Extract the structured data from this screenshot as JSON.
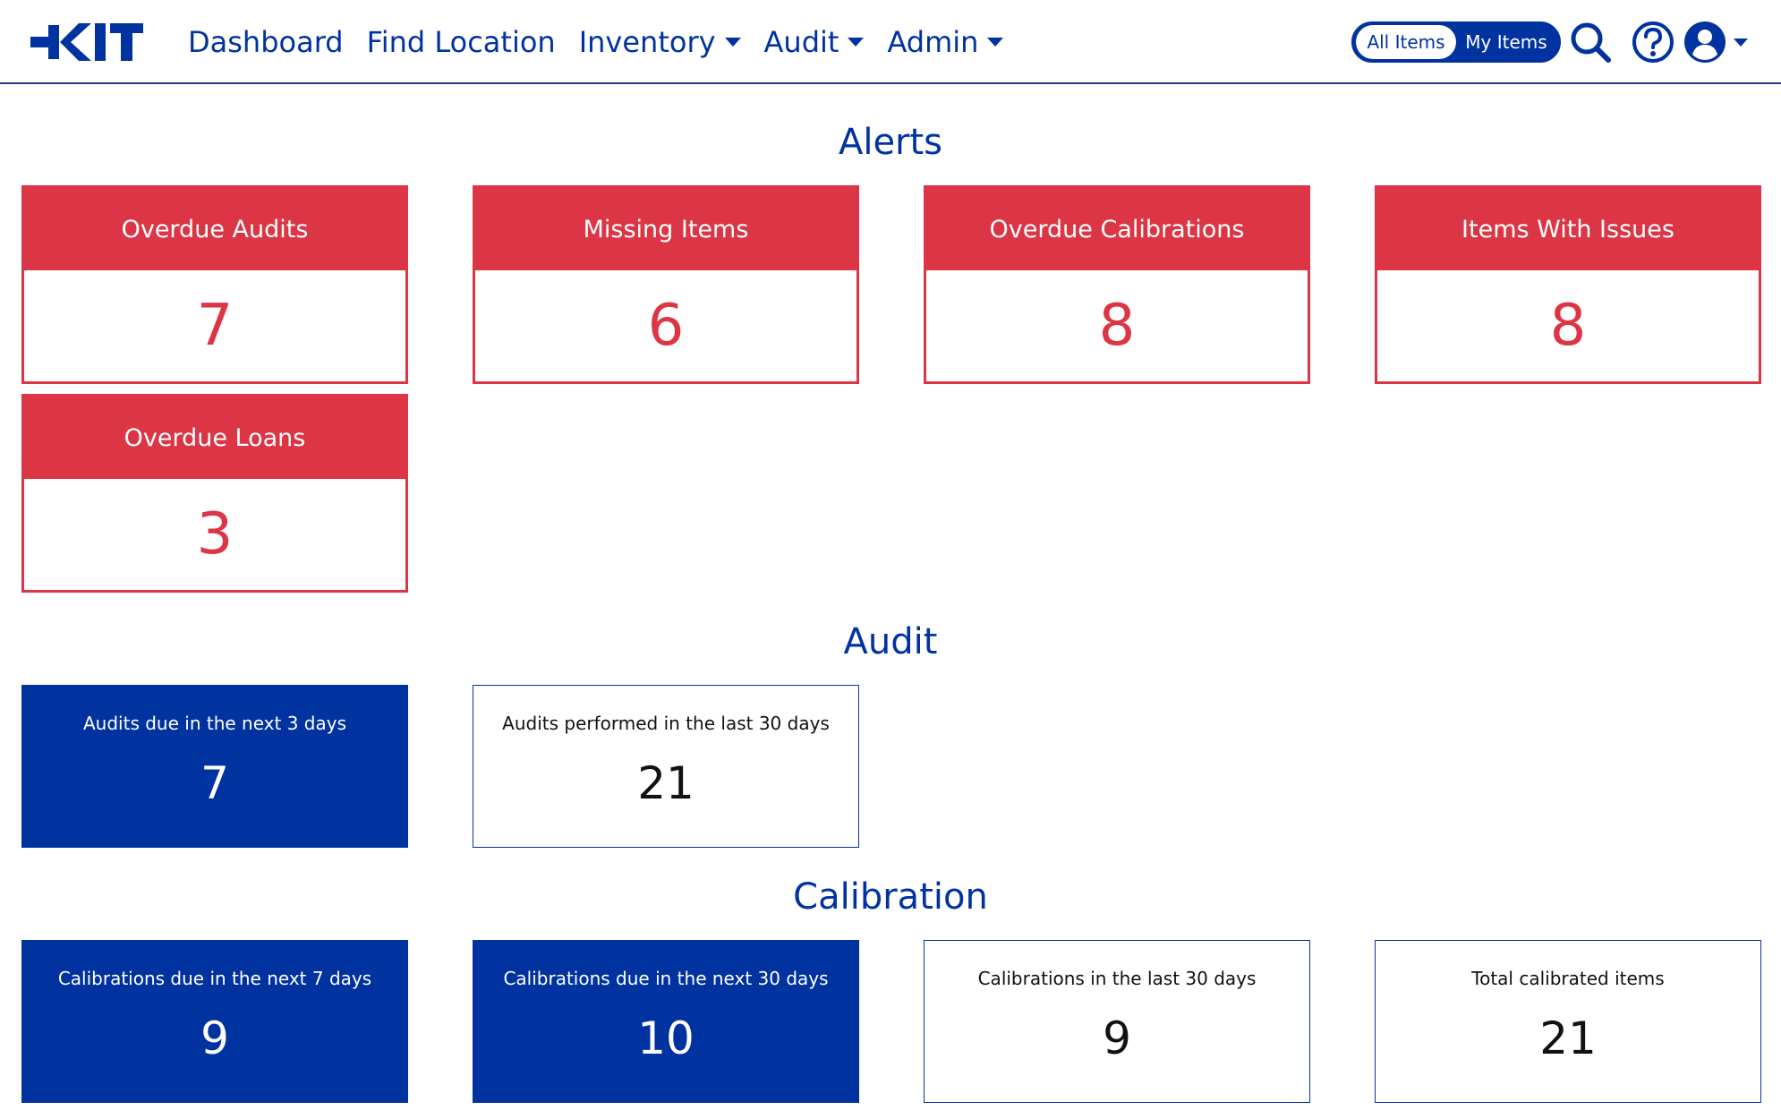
{
  "nav": {
    "logo_text": "KIT",
    "links": [
      {
        "label": "Dashboard",
        "dropdown": false
      },
      {
        "label": "Find Location",
        "dropdown": false
      },
      {
        "label": "Inventory",
        "dropdown": true
      },
      {
        "label": "Audit",
        "dropdown": true
      },
      {
        "label": "Admin",
        "dropdown": true
      }
    ],
    "toggle": {
      "all_items": "All Items",
      "my_items": "My Items",
      "selected": "My Items"
    },
    "icons": [
      "search-icon",
      "help-icon",
      "user-icon"
    ]
  },
  "alerts": {
    "title": "Alerts",
    "cards": [
      {
        "label": "Overdue Audits",
        "value": "7"
      },
      {
        "label": "Missing Items",
        "value": "6"
      },
      {
        "label": "Overdue Calibrations",
        "value": "8"
      },
      {
        "label": "Items With Issues",
        "value": "8"
      },
      {
        "label": "Overdue Loans",
        "value": "3"
      }
    ]
  },
  "audit": {
    "title": "Audit",
    "cards": [
      {
        "label": "Audits due in the next 3 days",
        "value": "7",
        "style": "filled"
      },
      {
        "label": "Audits performed in the last 30 days",
        "value": "21",
        "style": "outline"
      }
    ]
  },
  "calibration": {
    "title": "Calibration",
    "cards": [
      {
        "label": "Calibrations due in the next 7 days",
        "value": "9",
        "style": "filled"
      },
      {
        "label": "Calibrations due in the next 30 days",
        "value": "10",
        "style": "filled"
      },
      {
        "label": "Calibrations in the last 30 days",
        "value": "9",
        "style": "outline"
      },
      {
        "label": "Total calibrated items",
        "value": "21",
        "style": "outline"
      }
    ]
  },
  "colors": {
    "brand_blue": "#0033a0",
    "alert_red": "#dc3545"
  }
}
